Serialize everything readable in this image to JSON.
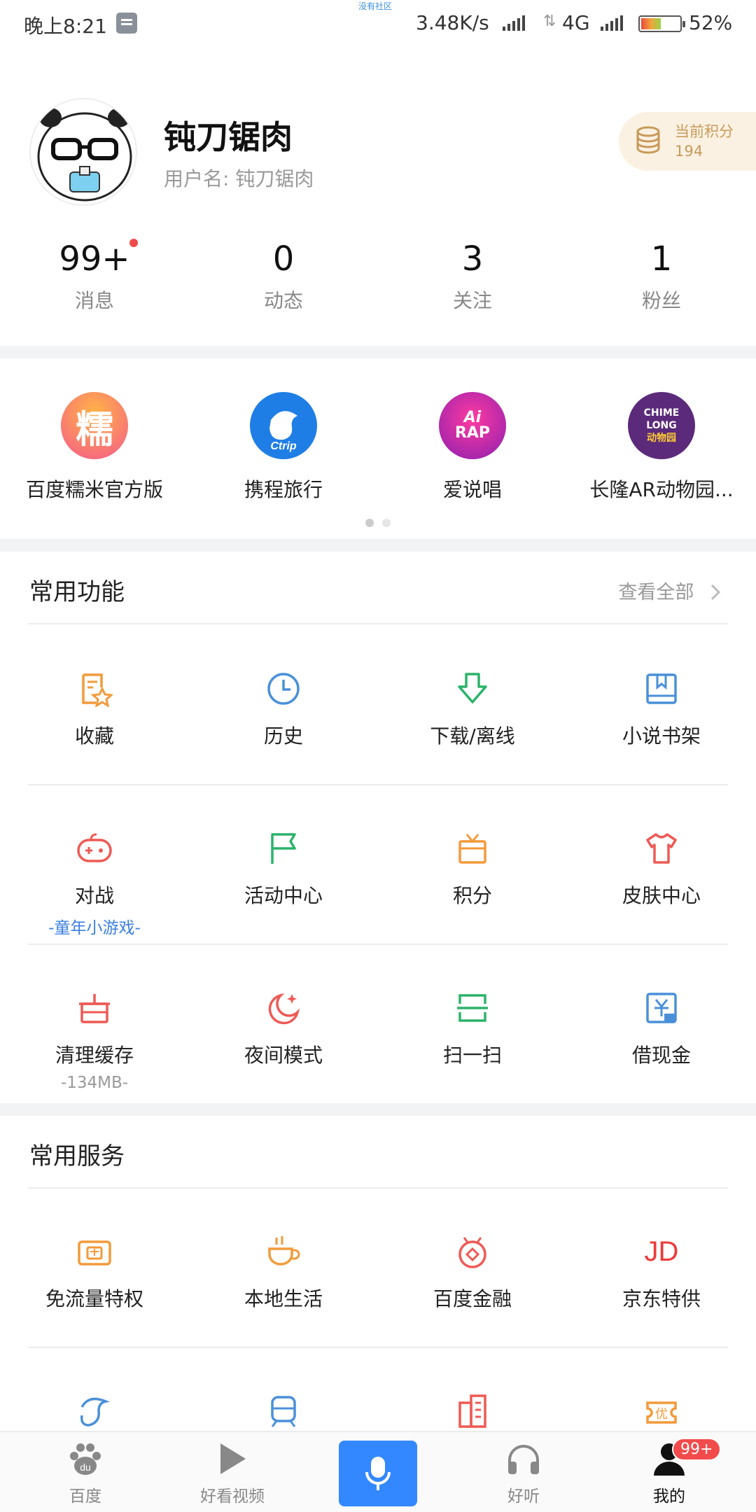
{
  "status_bar": {
    "time": "晚上8:21",
    "watermark": "没有社区",
    "speed": "3.48K/s",
    "network": "4G",
    "battery": "52%",
    "battery_level": 0.52
  },
  "profile": {
    "name": "钝刀锯肉",
    "username": "用户名: 钝刀锯肉",
    "points_label": "当前积分",
    "points_value": "194"
  },
  "stats": [
    {
      "value": "99+",
      "label": "消息"
    },
    {
      "value": "0",
      "label": "动态"
    },
    {
      "value": "3",
      "label": "关注"
    },
    {
      "value": "1",
      "label": "粉丝"
    }
  ],
  "apps": [
    {
      "name": "百度糯米官方版",
      "icon": "nuomi-icon",
      "glyph": "糯",
      "color": "#f55a8a"
    },
    {
      "name": "携程旅行",
      "icon": "ctrip-icon",
      "glyph": "Ctrip",
      "color": "#1f7ee6"
    },
    {
      "name": "爱说唱",
      "icon": "airap-icon",
      "glyph": "AiRAP",
      "color": "#c728a8"
    },
    {
      "name": "长隆AR动物园...",
      "icon": "chimelong-icon",
      "glyph": "CHIMELONG",
      "color": "#5b2a7a"
    }
  ],
  "common_functions": {
    "title": "常用功能",
    "see_all": "查看全部",
    "items": [
      {
        "label": "收藏",
        "icon": "favorite-icon",
        "color": "#f39a3a"
      },
      {
        "label": "历史",
        "icon": "history-clock-icon",
        "color": "#4a90d9"
      },
      {
        "label": "下载/离线",
        "icon": "download-icon",
        "color": "#2bb36a"
      },
      {
        "label": "小说书架",
        "icon": "bookshelf-icon",
        "color": "#4a90d9"
      },
      {
        "label": "对战",
        "sub": "-童年小游戏-",
        "icon": "gamepad-icon",
        "color": "#ee5a55",
        "sub_color": "#3a7fe0"
      },
      {
        "label": "活动中心",
        "icon": "flag-icon",
        "color": "#2bb36a"
      },
      {
        "label": "积分",
        "icon": "gift-icon",
        "color": "#f39a3a"
      },
      {
        "label": "皮肤中心",
        "icon": "tshirt-icon",
        "color": "#ee5a55"
      },
      {
        "label": "清理缓存",
        "sub": "-134MB-",
        "icon": "trash-icon",
        "color": "#ee5a55",
        "sub_color": "#999999"
      },
      {
        "label": "夜间模式",
        "icon": "moon-icon",
        "color": "#ee5a55"
      },
      {
        "label": "扫一扫",
        "icon": "scan-icon",
        "color": "#2bb36a"
      },
      {
        "label": "借现金",
        "icon": "cash-icon",
        "color": "#4a90d9"
      }
    ]
  },
  "common_services": {
    "title": "常用服务",
    "items": [
      {
        "label": "免流量特权",
        "icon": "data-card-icon",
        "color": "#f39a3a"
      },
      {
        "label": "本地生活",
        "icon": "coffee-cup-icon",
        "color": "#f39a3a"
      },
      {
        "label": "百度金融",
        "icon": "finance-icon",
        "color": "#ee5a55"
      },
      {
        "label": "京东特供",
        "icon": "jd-icon",
        "color": "#ee3a3a"
      }
    ],
    "partial_row_icons": [
      {
        "icon": "dolphin-icon",
        "color": "#4a90d9"
      },
      {
        "icon": "train-icon",
        "color": "#4a90d9"
      },
      {
        "icon": "building-icon",
        "color": "#ee5a55"
      },
      {
        "icon": "coupon-icon",
        "color": "#f39a3a"
      }
    ]
  },
  "bottom_nav": [
    {
      "label": "百度",
      "icon": "baidu-paw-icon"
    },
    {
      "label": "好看视频",
      "icon": "play-icon"
    },
    {
      "label": "",
      "icon": "microphone-icon"
    },
    {
      "label": "好听",
      "icon": "headphones-icon"
    },
    {
      "label": "我的",
      "icon": "user-icon",
      "badge": "99+",
      "active": true
    }
  ]
}
